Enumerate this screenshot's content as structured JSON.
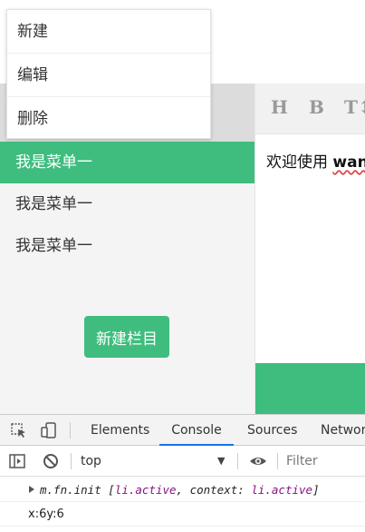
{
  "context_menu": {
    "items": [
      {
        "label": "新建"
      },
      {
        "label": "编辑"
      },
      {
        "label": "删除"
      }
    ]
  },
  "sidebar": {
    "items": [
      {
        "label": "我是菜单一",
        "active": true
      },
      {
        "label": "我是菜单一",
        "active": false
      },
      {
        "label": "我是菜单一",
        "active": false
      }
    ],
    "new_column_button": "新建栏目"
  },
  "editor": {
    "toolbar": [
      "H",
      "B",
      "T↕"
    ],
    "text_prefix": "欢迎使用 ",
    "text_bold": "wan"
  },
  "devtools": {
    "tabs": [
      {
        "label": "Elements",
        "active": false
      },
      {
        "label": "Console",
        "active": true
      },
      {
        "label": "Sources",
        "active": false
      },
      {
        "label": "Network",
        "active": false
      }
    ],
    "context": "top",
    "filter_placeholder": "Filter",
    "log": {
      "obj_name": "m.fn.init",
      "open": "[",
      "item1": "li.active",
      "comma": ", context: ",
      "item2": "li.active",
      "close": "]"
    },
    "log2": "x:6y:6"
  },
  "colors": {
    "accent": "#3ebd7e",
    "devtools_active_tab": "#1a73e8"
  }
}
